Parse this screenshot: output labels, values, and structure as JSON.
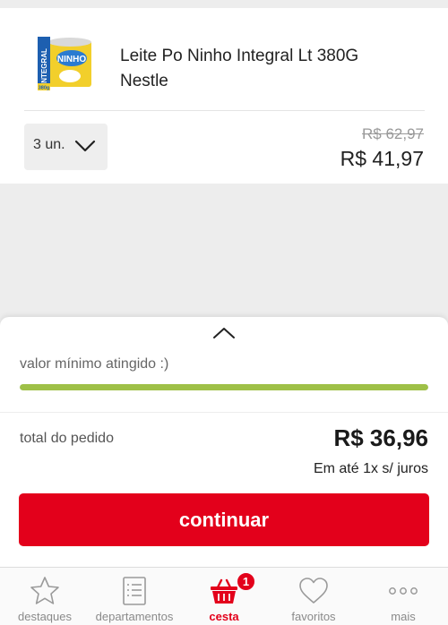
{
  "cart_item": {
    "name_line1": "Leite Po Ninho Integral Lt 380G",
    "name_line2": "Nestle",
    "thumbnail": {
      "icon": "milk-powder-can-icon",
      "brand_text": "NINHO",
      "badge_text": "INTEGRAL",
      "size_text": "380g"
    },
    "quantity": "3 un.",
    "price_original": "R$ 62,97",
    "price_current": "R$ 41,97"
  },
  "summary": {
    "min_status": "valor mínimo atingido :)",
    "progress_fraction": 1.0,
    "progress_color": "#9ec047",
    "total_label": "total do pedido",
    "total_value": "R$ 36,96",
    "installments": "Em até 1x s/ juros",
    "continue_label": "continuar",
    "accent_color": "#e3001b"
  },
  "nav": {
    "items": [
      {
        "label": "destaques",
        "icon": "star-icon"
      },
      {
        "label": "departamentos",
        "icon": "list-icon"
      },
      {
        "label": "cesta",
        "icon": "basket-icon",
        "badge": "1",
        "active": true
      },
      {
        "label": "favoritos",
        "icon": "heart-icon"
      },
      {
        "label": "mais",
        "icon": "more-dots-icon"
      }
    ]
  }
}
